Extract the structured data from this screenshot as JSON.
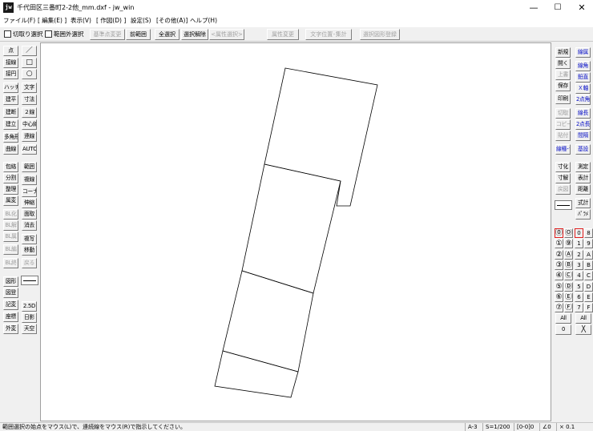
{
  "window": {
    "title": "千代田区三番町2-2他_mm.dxf - jw_win",
    "icon_label": "jw",
    "minimize_glyph": "—",
    "maximize_glyph": "☐",
    "close_glyph": "✕"
  },
  "menu": [
    "ファイル(F)",
    "[ 編集(E) ]",
    "表示(V)",
    "[ 作図(D) ]",
    "設定(S)",
    "[その他(A)]",
    "ヘルプ(H)"
  ],
  "toolbar": {
    "chk_range_select": "切取り選択",
    "chk_outside_select": "範囲外選択",
    "base_point_change": "基準点変更",
    "prev_range": "前範囲",
    "select_all": "全選択",
    "deselect": "選択解除",
    "attr_select": "<属性選択>",
    "attr_change": "属性変更",
    "text_pos_calc": "文字位置･集計",
    "select_fig_register": "選択図形登録"
  },
  "left_tools": {
    "point": "点",
    "line_glyph": "／",
    "jiku": "接線",
    "rect_glyph": "□",
    "circle_t": "接円",
    "circle_glyph": "○",
    "hatch": "ハッチ",
    "text": "文字",
    "tatehira": "建平",
    "dim": "寸法",
    "tatedan": "建断",
    "double_line": "２線",
    "tateritsu": "建立",
    "center_line": "中心線",
    "polygon": "多角形",
    "cont_line": "連線",
    "curve": "曲線",
    "auto": "AUTO",
    "enclose": "包絡",
    "range": "範囲",
    "divide": "分割",
    "multi_line": "複線",
    "arrange": "整理",
    "corner": "コーナー",
    "attr_change": "属変",
    "stretch": "伸縮",
    "bl_make": "BL化",
    "chamfer": "面取",
    "bl_release": "BL解",
    "erase": "消去",
    "bl_attr": "BL属",
    "copy": "複写",
    "bl_edit": "BL編",
    "move": "移動",
    "bl_end": "BL終",
    "undo": "戻る",
    "figure": "図形",
    "fig_register": "図登",
    "mark": "記変",
    "two_five_d": "2.5D",
    "coords": "座標",
    "sunshadow": "日影",
    "external": "外変",
    "sky": "天空"
  },
  "right_tools": {
    "new": "新規",
    "layer_btn": "線属",
    "open": "開く",
    "line_angle": "線角",
    "overwrite": "上書",
    "vertical": "鉛直",
    "save": "保存",
    "x_axis": "Ｘ軸",
    "print": "印刷",
    "two_point_angle": "2点角",
    "cut": "切取",
    "line_len": "線長",
    "copy": "コピー",
    "two_point_len": "2点長",
    "paste": "貼付",
    "spacing": "間隔",
    "layer_config": "線種･色",
    "assign": "基設",
    "dim_value": "寸化",
    "measure": "測定",
    "dim_solve": "寸解",
    "table_calc": "表計",
    "return_draw": "戻図",
    "distance": "距離",
    "formula": "式計",
    "param": "ﾊﾟﾗﾒ",
    "layer_grid": [
      [
        "⓪",
        "Ⓞ",
        "0",
        "8"
      ],
      [
        "①",
        "⑨",
        "1",
        "9"
      ],
      [
        "②",
        "Ⓐ",
        "2",
        "A"
      ],
      [
        "③",
        "Ⓑ",
        "3",
        "B"
      ],
      [
        "④",
        "Ⓒ",
        "4",
        "C"
      ],
      [
        "⑤",
        "Ⓓ",
        "5",
        "D"
      ],
      [
        "⑥",
        "Ⓔ",
        "6",
        "E"
      ],
      [
        "⑦",
        "Ⓕ",
        "7",
        "F"
      ]
    ],
    "all_left": "All",
    "all_right": "All",
    "zero": "0",
    "cross_glyph": "╳"
  },
  "status": {
    "message": "範囲選択の始点をマウス(L)で、連続線をマウス(R)で指示してください。",
    "paper": "A-3",
    "scale": "S=1/200",
    "layer": "[0-0]0",
    "angle": "∠0",
    "factor": "× 0.1"
  },
  "colors": {
    "highlight_blue": "#0a12c8",
    "active_red": "#e02020"
  }
}
